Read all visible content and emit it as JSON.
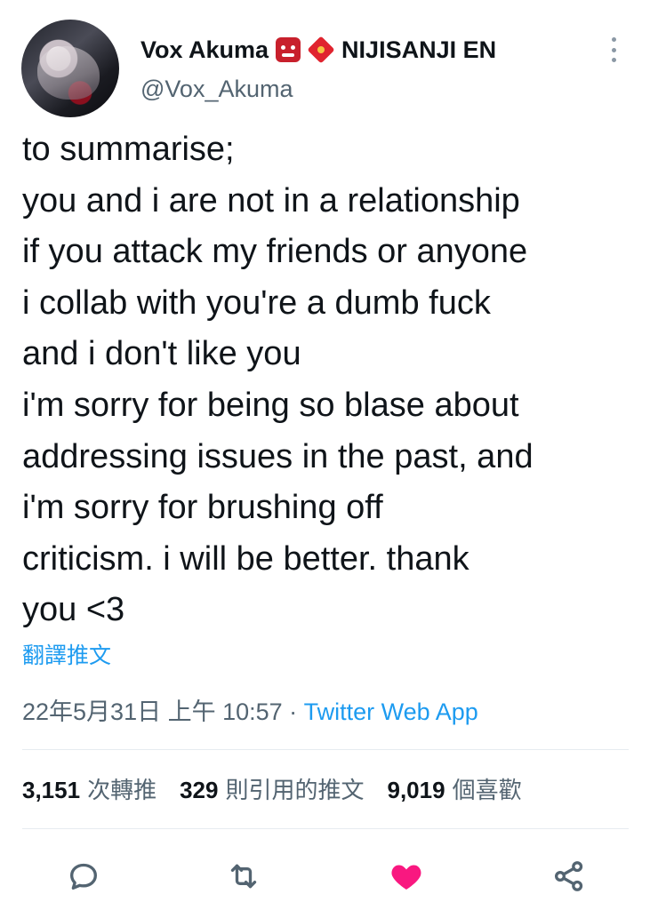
{
  "author": {
    "display_name": "Vox Akuma",
    "affiliation": "NIJISANJI EN",
    "handle": "@Vox_Akuma"
  },
  "tweet": {
    "lines": [
      "to summarise;",
      "you and i are not in a relationship",
      "if you attack my friends or anyone",
      "i collab with you're a dumb fuck",
      "and i don't like you",
      "i'm sorry for being so blase about",
      "addressing issues in the past, and",
      "i'm sorry for brushing off",
      "criticism. i will be better. thank",
      "you <3"
    ],
    "translate_label": "翻譯推文"
  },
  "meta": {
    "timestamp": "22年5月31日 上午 10:57",
    "separator": " · ",
    "source": "Twitter Web App"
  },
  "stats": {
    "retweets_count": "3,151",
    "retweets_label": "次轉推",
    "quotes_count": "329",
    "quotes_label": "則引用的推文",
    "likes_count": "9,019",
    "likes_label": "個喜歡"
  },
  "actions": {
    "reply_icon": "reply-icon",
    "retweet_icon": "retweet-icon",
    "like_icon": "heart-filled-icon",
    "share_icon": "share-icon",
    "like_color": "#f91880",
    "icon_color": "#536471"
  }
}
